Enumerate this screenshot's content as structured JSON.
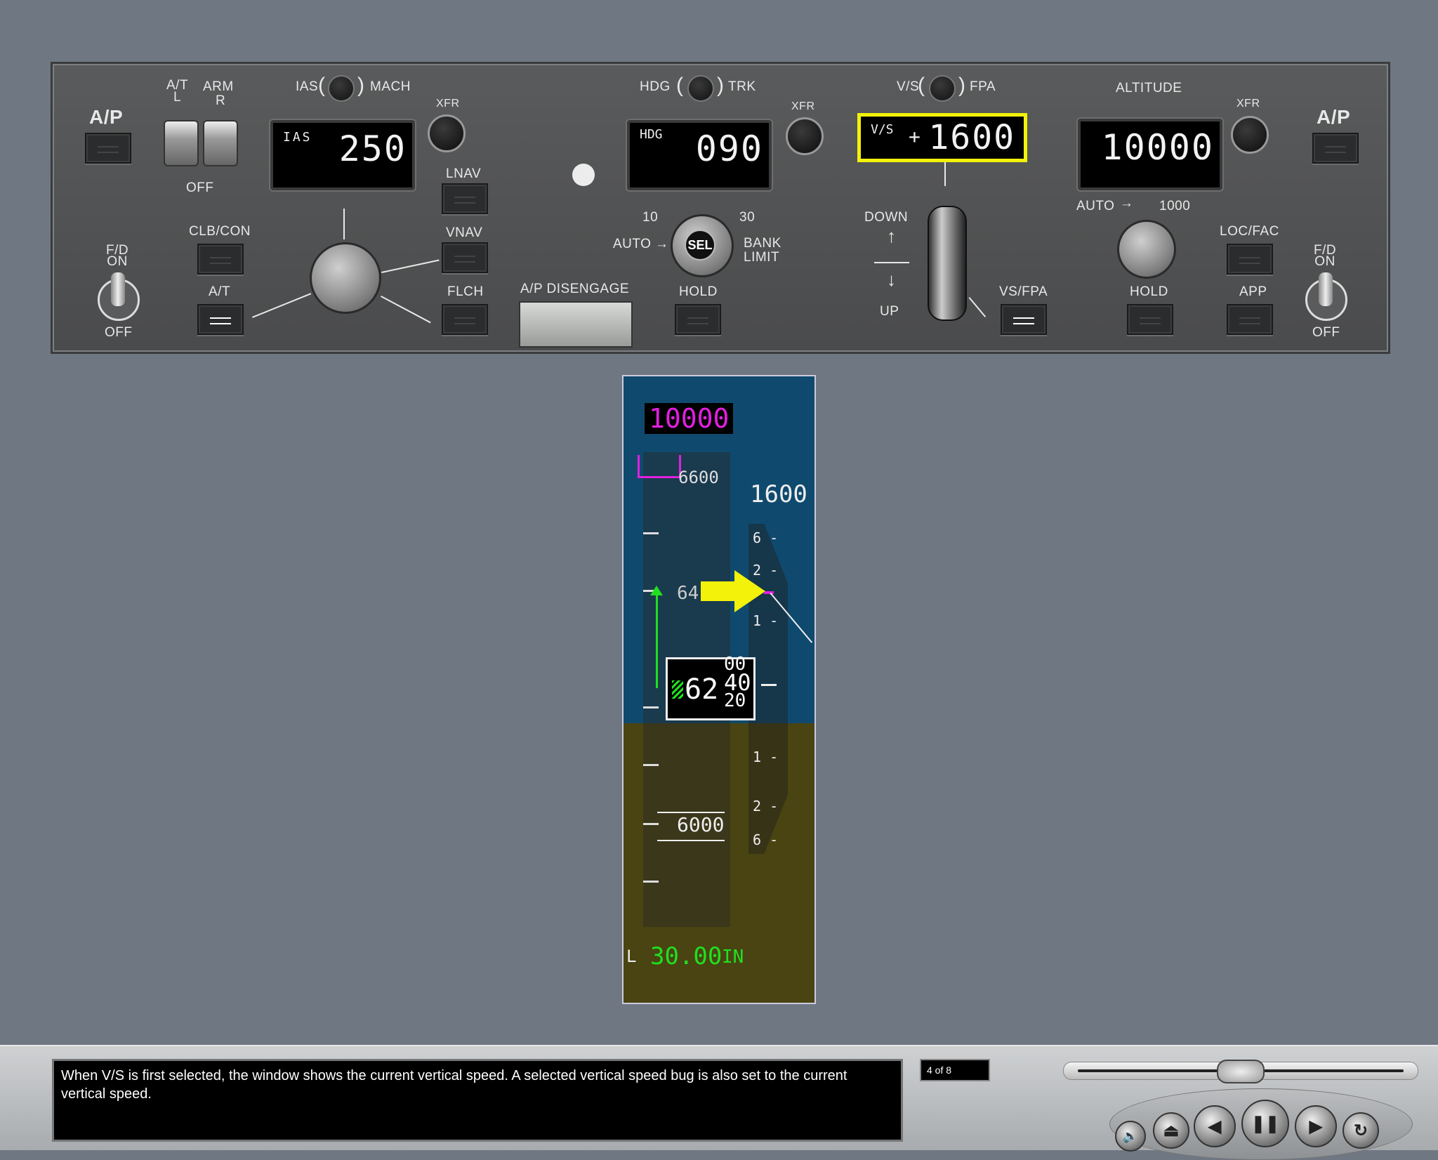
{
  "mcp": {
    "left_ap_label": "A/P",
    "right_ap_label": "A/P",
    "at_l_label": "A/T\nL",
    "arm_label": "ARM",
    "r_label": "R",
    "at_off_label": "OFF",
    "fd_left_on": "F/D\nON",
    "fd_left_off": "OFF",
    "fd_right_on": "F/D\nON",
    "fd_right_off": "OFF",
    "clb_con": "CLB/CON",
    "at_button": "A/T",
    "ias_mach": {
      "left": "IAS",
      "right": "MACH"
    },
    "ias_display": {
      "label": "IAS",
      "value": "250"
    },
    "xfr1": "XFR",
    "lnav": "LNAV",
    "vnav": "VNAV",
    "flch": "FLCH",
    "ap_disengage": "A/P DISENGAGE",
    "hdg_trk": {
      "left": "HDG",
      "right": "TRK"
    },
    "hdg_display": {
      "label": "HDG",
      "value": "090"
    },
    "xfr2": "XFR",
    "bank": {
      "ten": "10",
      "thirty": "30",
      "auto": "AUTO",
      "sel": "SEL",
      "bank_limit": "BANK\nLIMIT"
    },
    "hold_hdg": "HOLD",
    "vs_fpa": {
      "left": "V/S",
      "right": "FPA"
    },
    "vs_display": {
      "label": "V/S",
      "sign": "+",
      "value": "1600"
    },
    "down": "DOWN",
    "up": "UP",
    "vs_fpa_button": "VS/FPA",
    "altitude_label": "ALTITUDE",
    "alt_display": {
      "value": "10000"
    },
    "xfr3": "XFR",
    "alt_auto": "AUTO",
    "alt_1000": "1000",
    "loc_fac": "LOC/FAC",
    "hold_alt": "HOLD",
    "app": "APP",
    "highlight_color": "#f2f20a"
  },
  "pfd": {
    "selected_alt": "10000",
    "alt_upper": "6600",
    "vs_readout": "1600",
    "vs_scale_top": [
      "6 -",
      "2 -",
      "1 -"
    ],
    "vs_scale_bottom": [
      "1 -",
      "2 -",
      "6 -"
    ],
    "current_alt_big": "62",
    "alt_roll": [
      "00",
      "40",
      "20"
    ],
    "alt_tape_64": "64",
    "alt_lower": "6000",
    "baro": {
      "prefix": "L",
      "value": "30.00",
      "unit": "IN"
    },
    "bug_color": "#e020e0",
    "trend_color": "#20e020"
  },
  "footer": {
    "caption": "When V/S is first selected, the window shows the current vertical speed. A selected vertical speed bug is also set to the current vertical speed.",
    "pager": "4 of 8"
  }
}
